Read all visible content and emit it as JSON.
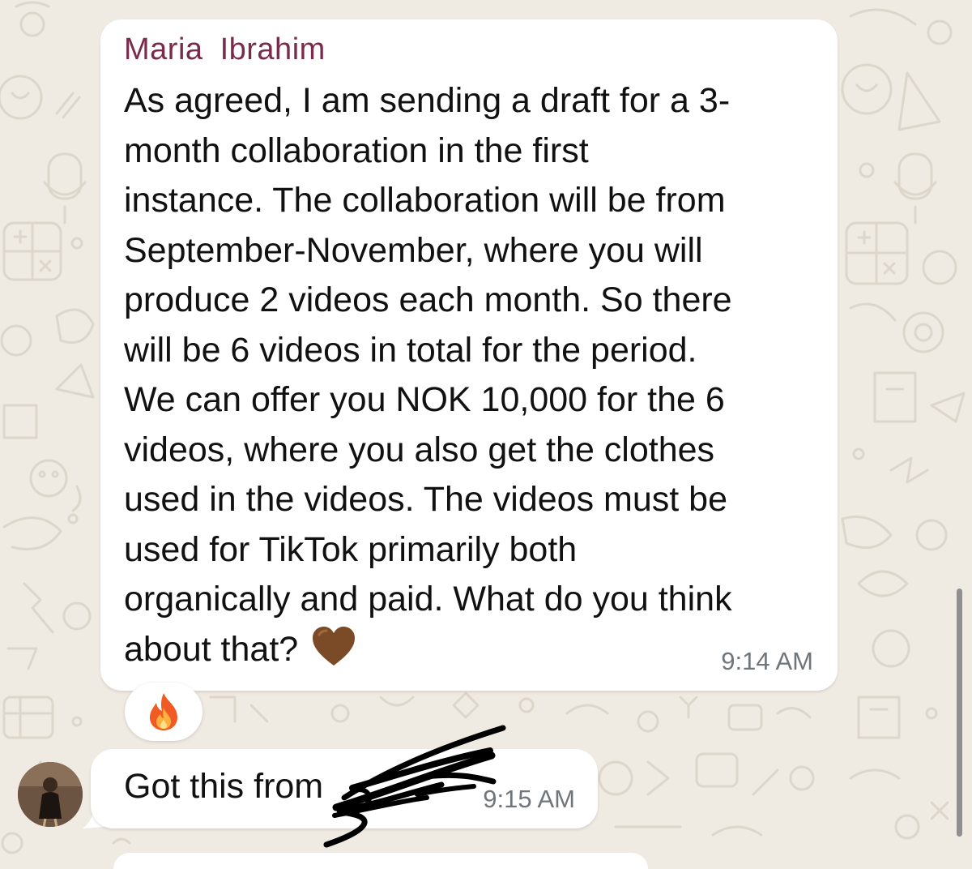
{
  "chat": {
    "message_1": {
      "sender": "Maria  Ibrahim",
      "lines": [
        "As agreed, I am sending a draft for a 3-",
        "month collaboration in the first",
        "instance. The collaboration will be from",
        "September-November, where you will",
        "produce 2 videos each month. So there",
        "will be 6 videos in total for the period.",
        "We can offer you NOK 10,000 for the 6",
        "videos, where you also get the clothes",
        "used in the videos. The videos must be",
        "used for TikTok primarily both",
        "organically and paid. What do you think",
        "about that?"
      ],
      "emoji": "brown-heart",
      "time": "9:14 AM",
      "reaction": "fire-emoji"
    },
    "message_2": {
      "text": "Got this from",
      "redacted_name_hint": "E",
      "time": "9:15 AM"
    }
  },
  "colors": {
    "wallpaper": "#efeae2",
    "bubble": "#ffffff",
    "sender_name": "#7a2a4b",
    "timestamp": "#70757a",
    "heart": "#7b4a26"
  }
}
